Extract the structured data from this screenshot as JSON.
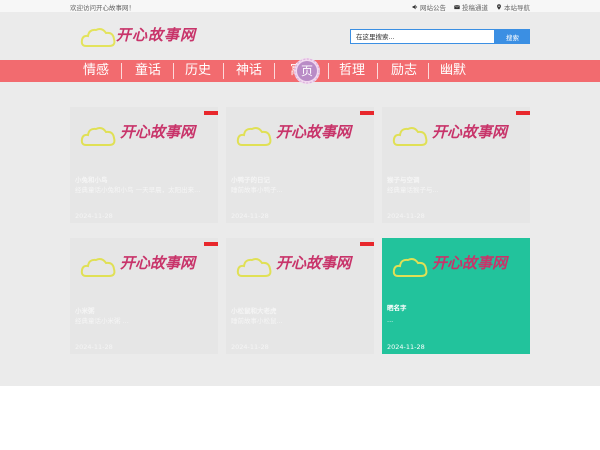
{
  "topbar": {
    "welcome": "欢迎访问开心故事网！",
    "links": [
      {
        "label": "网站公告",
        "icon": "speaker-icon"
      },
      {
        "label": "投稿通道",
        "icon": "mail-icon"
      },
      {
        "label": "本站导航",
        "icon": "location-pin-icon"
      }
    ]
  },
  "logo": {
    "text": "开心故事网",
    "accent": "#e8e84a",
    "text_color": "#c8346a"
  },
  "search": {
    "placeholder": "在这里搜索...",
    "button_label": "搜索"
  },
  "nav": {
    "items": [
      "情感",
      "童话",
      "历史",
      "神话",
      "寓言",
      "哲理",
      "励志",
      "幽默"
    ],
    "badge": "页",
    "color": "#f26b6f"
  },
  "cards": [
    {
      "title": "小兔和小鸟",
      "summary": "经典童话小兔和小鸟 一天早晨，太阳出来...",
      "date": "2024-11-28",
      "tag": "hot"
    },
    {
      "title": "小鸭子的日记",
      "summary": "睡前故事小鸭子...",
      "date": "2024-11-28",
      "tag": "hot"
    },
    {
      "title": "猴子与空调",
      "summary": "经典童话猴子与...",
      "date": "2024-11-28",
      "tag": "hot"
    },
    {
      "title": "小米粥",
      "summary": "经典童话小米粥 ...",
      "date": "2024-11-28",
      "tag": "hot"
    },
    {
      "title": "小松鼠和大老虎",
      "summary": "睡前故事小松鼠...",
      "date": "2024-11-28",
      "tag": "hot"
    },
    {
      "title": "晒名字",
      "summary": "...",
      "date": "2024-11-28",
      "tag": ""
    }
  ]
}
